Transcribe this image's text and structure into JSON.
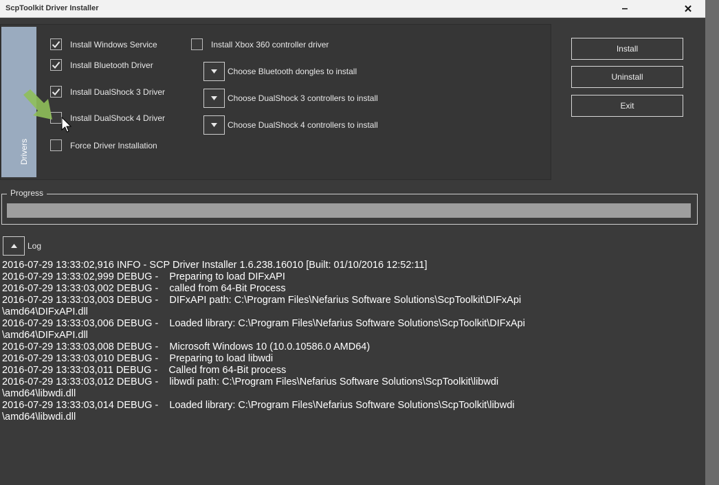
{
  "window": {
    "title": "ScpToolkit Driver Installer",
    "minimize_glyph": "–",
    "close_glyph": "✕"
  },
  "sidebar": {
    "tab_label": "Drivers"
  },
  "options": {
    "install_windows_service": {
      "label": "Install Windows Service",
      "checked": true
    },
    "install_bluetooth_driver": {
      "label": "Install Bluetooth Driver",
      "checked": true
    },
    "install_ds3_driver": {
      "label": "Install DualShock 3 Driver",
      "checked": true
    },
    "install_ds4_driver": {
      "label": "Install DualShock 4 Driver",
      "checked": false
    },
    "force_driver_installation": {
      "label": "Force Driver Installation",
      "checked": false
    },
    "install_xbox360_driver": {
      "label": "Install Xbox 360 controller driver",
      "checked": false
    }
  },
  "dropdowns": {
    "bluetooth_dongles": {
      "label": "Choose Bluetooth dongles to install"
    },
    "ds3_controllers": {
      "label": "Choose DualShock 3 controllers to install"
    },
    "ds4_controllers": {
      "label": "Choose DualShock 4 controllers to install"
    }
  },
  "actions": {
    "install": "Install",
    "uninstall": "Uninstall",
    "exit": "Exit"
  },
  "progress": {
    "label": "Progress",
    "value": 0
  },
  "log": {
    "label": "Log",
    "lines": [
      "2016-07-29 13:33:02,916 INFO - SCP Driver Installer 1.6.238.16010 [Built: 01/10/2016 12:52:11]",
      "2016-07-29 13:33:02,999 DEBUG -    Preparing to load DIFxAPI",
      "2016-07-29 13:33:03,002 DEBUG -    called from 64-Bit Process",
      "2016-07-29 13:33:03,003 DEBUG -    DIFxAPI path: C:\\Program Files\\Nefarius Software Solutions\\ScpToolkit\\DIFxApi",
      "\\amd64\\DIFxAPI.dll",
      "2016-07-29 13:33:03,006 DEBUG -    Loaded library: C:\\Program Files\\Nefarius Software Solutions\\ScpToolkit\\DIFxApi",
      "\\amd64\\DIFxAPI.dll",
      "2016-07-29 13:33:03,008 DEBUG -    Microsoft Windows 10 (10.0.10586.0 AMD64)",
      "2016-07-29 13:33:03,010 DEBUG -    Preparing to load libwdi",
      "2016-07-29 13:33:03,011 DEBUG -    Called from 64-Bit process",
      "2016-07-29 13:33:03,012 DEBUG -    libwdi path: C:\\Program Files\\Nefarius Software Solutions\\ScpToolkit\\libwdi",
      "\\amd64\\libwdi.dll",
      "2016-07-29 13:33:03,014 DEBUG -    Loaded library: C:\\Program Files\\Nefarius Software Solutions\\ScpToolkit\\libwdi",
      "\\amd64\\libwdi.dll"
    ]
  },
  "colors": {
    "background": "#3a3a3a",
    "tab": "#9aabbf",
    "progress_track": "#9e9e9e",
    "arrow": "#8fbf5a"
  }
}
